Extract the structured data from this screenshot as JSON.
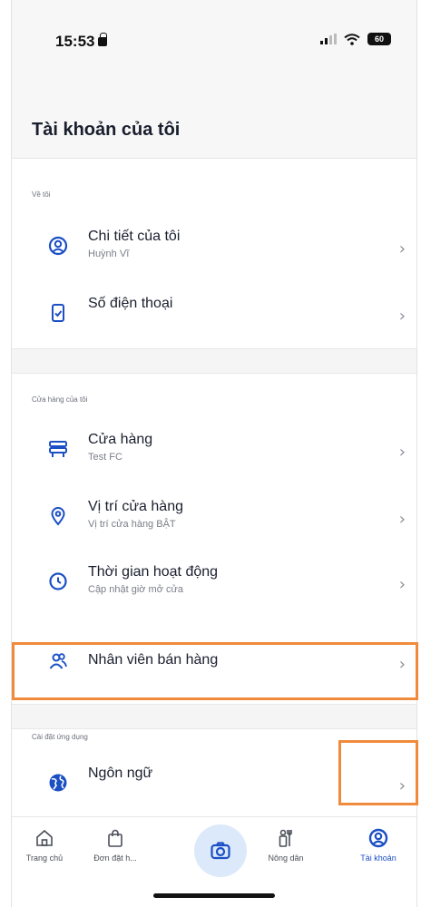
{
  "status_bar": {
    "time": "15:53",
    "battery": "60"
  },
  "header": {
    "title": "Tài khoản của tôi"
  },
  "sections": {
    "about_me": {
      "label": "Về tôi",
      "items": [
        {
          "title": "Chi tiết của tôi",
          "subtitle": "Huỳnh Vĩ",
          "icon": "user-circle-icon"
        },
        {
          "title": "Số điện thoại",
          "subtitle": "",
          "icon": "phone-check-icon"
        }
      ]
    },
    "my_store": {
      "label": "Cửa hàng của tôi",
      "items": [
        {
          "title": "Cửa hàng",
          "subtitle": "Test FC",
          "icon": "store-icon"
        },
        {
          "title": "Vị trí cửa hàng",
          "subtitle": "Vị trí cửa hàng BẬT",
          "icon": "location-pin-icon"
        },
        {
          "title": "Thời gian hoạt động",
          "subtitle": "Cập nhật giờ mở cửa",
          "icon": "clock-icon"
        },
        {
          "title": "Nhân viên bán hàng",
          "subtitle": "",
          "icon": "staff-icon"
        }
      ]
    },
    "app_settings": {
      "label": "Cài đặt ứng dụng",
      "items": [
        {
          "title": "Ngôn ngữ",
          "subtitle": "",
          "icon": "globe-icon"
        }
      ]
    }
  },
  "tabbar": {
    "tabs": [
      {
        "label": "Trang chủ",
        "icon": "home-icon"
      },
      {
        "label": "Đơn đặt h...",
        "icon": "shopping-bag-icon"
      },
      {
        "label": "",
        "icon": "camera-icon"
      },
      {
        "label": "Nông dân",
        "icon": "farmer-icon"
      },
      {
        "label": "Tài khoản",
        "icon": "account-icon"
      }
    ]
  },
  "colors": {
    "accent": "#1b4fc4",
    "highlight": "#f08a3c",
    "text": "#1a1f2e",
    "muted": "#7a7e88"
  }
}
